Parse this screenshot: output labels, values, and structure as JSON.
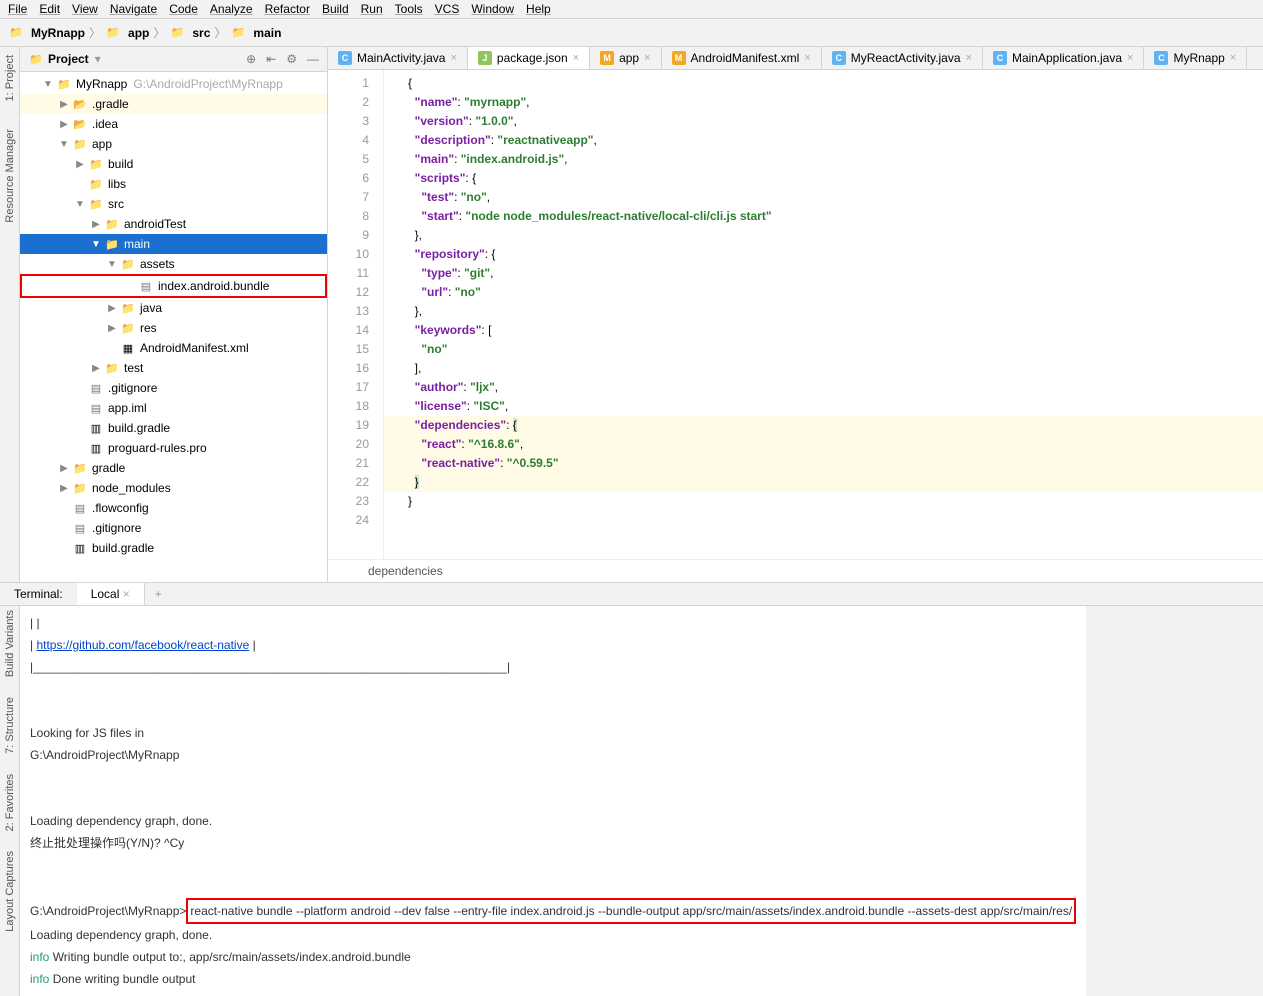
{
  "menu": [
    "File",
    "Edit",
    "View",
    "Navigate",
    "Code",
    "Analyze",
    "Refactor",
    "Build",
    "Run",
    "Tools",
    "VCS",
    "Window",
    "Help"
  ],
  "breadcrumbs": [
    "MyRnapp",
    "app",
    "src",
    "main"
  ],
  "leftTabs": {
    "project": "1: Project",
    "resmgr": "Resource Manager"
  },
  "projectPanel": {
    "title": "Project"
  },
  "tree": {
    "root": {
      "name": "MyRnapp",
      "path": "G:\\AndroidProject\\MyRnapp"
    },
    "items": [
      {
        "indent": 1,
        "arrow": "▼",
        "icon": "folder-blue",
        "label": "MyRnapp",
        "extra": "G:\\AndroidProject\\MyRnapp"
      },
      {
        "indent": 2,
        "arrow": "▶",
        "icon": "folder-o",
        "label": ".gradle",
        "hl": true
      },
      {
        "indent": 2,
        "arrow": "▶",
        "icon": "folder-o",
        "label": ".idea"
      },
      {
        "indent": 2,
        "arrow": "▼",
        "icon": "folder-blue",
        "label": "app"
      },
      {
        "indent": 3,
        "arrow": "▶",
        "icon": "folder-gray",
        "label": "build"
      },
      {
        "indent": 3,
        "arrow": "",
        "icon": "folder-gray",
        "label": "libs"
      },
      {
        "indent": 3,
        "arrow": "▼",
        "icon": "folder-blue",
        "label": "src"
      },
      {
        "indent": 4,
        "arrow": "▶",
        "icon": "folder-gray",
        "label": "androidTest"
      },
      {
        "indent": 4,
        "arrow": "▼",
        "icon": "folder-blue",
        "label": "main",
        "sel": true
      },
      {
        "indent": 5,
        "arrow": "▼",
        "icon": "folder-gray",
        "label": "assets"
      },
      {
        "indent": 6,
        "arrow": "",
        "icon": "file-icon",
        "label": "index.android.bundle",
        "red": true
      },
      {
        "indent": 5,
        "arrow": "▶",
        "icon": "folder-blue",
        "label": "java"
      },
      {
        "indent": 5,
        "arrow": "▶",
        "icon": "folder-gray",
        "label": "res"
      },
      {
        "indent": 5,
        "arrow": "",
        "icon": "file-m",
        "label": "AndroidManifest.xml"
      },
      {
        "indent": 4,
        "arrow": "▶",
        "icon": "folder-gray",
        "label": "test"
      },
      {
        "indent": 3,
        "arrow": "",
        "icon": "file-icon",
        "label": ".gitignore"
      },
      {
        "indent": 3,
        "arrow": "",
        "icon": "file-icon",
        "label": "app.iml"
      },
      {
        "indent": 3,
        "arrow": "",
        "icon": "file-g",
        "label": "build.gradle"
      },
      {
        "indent": 3,
        "arrow": "",
        "icon": "file-g",
        "label": "proguard-rules.pro"
      },
      {
        "indent": 2,
        "arrow": "▶",
        "icon": "folder-gray",
        "label": "gradle"
      },
      {
        "indent": 2,
        "arrow": "▶",
        "icon": "folder-gray",
        "label": "node_modules"
      },
      {
        "indent": 2,
        "arrow": "",
        "icon": "file-icon",
        "label": ".flowconfig"
      },
      {
        "indent": 2,
        "arrow": "",
        "icon": "file-icon",
        "label": ".gitignore"
      },
      {
        "indent": 2,
        "arrow": "",
        "icon": "file-g",
        "label": "build.gradle"
      }
    ]
  },
  "editorTabs": [
    {
      "icon": "c",
      "label": "MainActivity.java"
    },
    {
      "icon": "j",
      "label": "package.json",
      "active": true
    },
    {
      "icon": "m",
      "label": "app"
    },
    {
      "icon": "m",
      "label": "AndroidManifest.xml"
    },
    {
      "icon": "c",
      "label": "MyReactActivity.java"
    },
    {
      "icon": "c",
      "label": "MainApplication.java"
    },
    {
      "icon": "c",
      "label": "MyRnapp"
    }
  ],
  "code": {
    "lines": 24,
    "content": [
      {
        "n": 1,
        "html": "{"
      },
      {
        "n": 2,
        "html": "  <span class='k'>\"name\"</span>: <span class='s'>\"myrnapp\"</span>,"
      },
      {
        "n": 3,
        "html": "  <span class='k'>\"version\"</span>: <span class='s'>\"1.0.0\"</span>,"
      },
      {
        "n": 4,
        "html": "  <span class='k'>\"description\"</span>: <span class='s'>\"reactnativeapp\"</span>,"
      },
      {
        "n": 5,
        "html": "  <span class='k'>\"main\"</span>: <span class='s'>\"index.android.js\"</span>,"
      },
      {
        "n": 6,
        "html": "  <span class='k'>\"scripts\"</span>: {"
      },
      {
        "n": 7,
        "html": "    <span class='k'>\"test\"</span>: <span class='s'>\"no\"</span>,"
      },
      {
        "n": 8,
        "html": "    <span class='k'>\"start\"</span>: <span class='s'>\"node node_modules/react-native/local-cli/cli.js start\"</span>"
      },
      {
        "n": 9,
        "html": "  },"
      },
      {
        "n": 10,
        "html": "  <span class='k'>\"repository\"</span>: {"
      },
      {
        "n": 11,
        "html": "    <span class='k'>\"type\"</span>: <span class='s'>\"git\"</span>,"
      },
      {
        "n": 12,
        "html": "    <span class='k'>\"url\"</span>: <span class='s'>\"no\"</span>"
      },
      {
        "n": 13,
        "html": "  },"
      },
      {
        "n": 14,
        "html": "  <span class='k'>\"keywords\"</span>: ["
      },
      {
        "n": 15,
        "html": "    <span class='s'>\"no\"</span>"
      },
      {
        "n": 16,
        "html": "  ],"
      },
      {
        "n": 17,
        "html": "  <span class='k'>\"author\"</span>: <span class='s'>\"ljx\"</span>,"
      },
      {
        "n": 18,
        "html": "  <span class='k'>\"license\"</span>: <span class='s'>\"ISC\"</span>,"
      },
      {
        "n": 19,
        "html": "  <span class='k'>\"dependencies\"</span>: <span style='background:#cfe8cf'>{</span>",
        "hl": true
      },
      {
        "n": 20,
        "html": "    <span class='k'>\"react\"</span>: <span class='s'>\"^16.8.6\"</span>,",
        "hl": true
      },
      {
        "n": 21,
        "html": "    <span class='k'>\"react-native\"</span>: <span class='s'>\"^0.59.5\"</span>",
        "hl": true
      },
      {
        "n": 22,
        "html": "  <span style='background:#cfe8cf'>}</span>",
        "hl": true
      },
      {
        "n": 23,
        "html": "}"
      },
      {
        "n": 24,
        "html": ""
      }
    ],
    "breadcrumb": "dependencies"
  },
  "terminal": {
    "label": "Terminal:",
    "tab": "Local",
    "lines": [
      "|                                                                       |",
      "| <a href='#'>https://github.com/facebook/react-native</a>                             |",
      "|_______________________________________________________________________|",
      "",
      "",
      "Looking for JS files in",
      "   G:\\AndroidProject\\MyRnapp",
      "",
      "",
      "Loading dependency graph, done.",
      "终止批处理操作吗(Y/N)? ^Cy",
      "",
      "",
      "G:\\AndroidProject\\MyRnapp><span class='redcmd'>react-native bundle --platform android --dev false --entry-file index.android.js --bundle-output app/src/main/assets/index.android.bundle --assets-dest app/src/main/res/</span>",
      "Loading dependency graph, done.",
      "<span class='info'>info</span> Writing bundle output to:, app/src/main/assets/index.android.bundle",
      "<span class='info'>info</span> Done writing bundle output"
    ]
  },
  "bottomTabs": [
    "Build Variants",
    "7: Structure",
    "2: Favorites",
    "Layout Captures"
  ]
}
